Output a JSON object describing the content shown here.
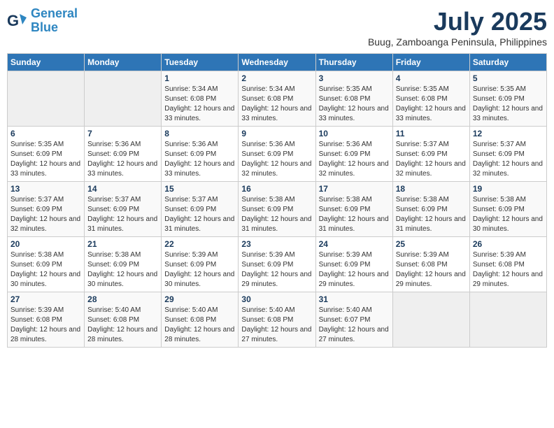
{
  "header": {
    "logo_line1": "General",
    "logo_line2": "Blue",
    "month": "July 2025",
    "location": "Buug, Zamboanga Peninsula, Philippines"
  },
  "days_of_week": [
    "Sunday",
    "Monday",
    "Tuesday",
    "Wednesday",
    "Thursday",
    "Friday",
    "Saturday"
  ],
  "weeks": [
    [
      {
        "day": "",
        "info": ""
      },
      {
        "day": "",
        "info": ""
      },
      {
        "day": "1",
        "info": "Sunrise: 5:34 AM\nSunset: 6:08 PM\nDaylight: 12 hours and 33 minutes."
      },
      {
        "day": "2",
        "info": "Sunrise: 5:34 AM\nSunset: 6:08 PM\nDaylight: 12 hours and 33 minutes."
      },
      {
        "day": "3",
        "info": "Sunrise: 5:35 AM\nSunset: 6:08 PM\nDaylight: 12 hours and 33 minutes."
      },
      {
        "day": "4",
        "info": "Sunrise: 5:35 AM\nSunset: 6:08 PM\nDaylight: 12 hours and 33 minutes."
      },
      {
        "day": "5",
        "info": "Sunrise: 5:35 AM\nSunset: 6:09 PM\nDaylight: 12 hours and 33 minutes."
      }
    ],
    [
      {
        "day": "6",
        "info": "Sunrise: 5:35 AM\nSunset: 6:09 PM\nDaylight: 12 hours and 33 minutes."
      },
      {
        "day": "7",
        "info": "Sunrise: 5:36 AM\nSunset: 6:09 PM\nDaylight: 12 hours and 33 minutes."
      },
      {
        "day": "8",
        "info": "Sunrise: 5:36 AM\nSunset: 6:09 PM\nDaylight: 12 hours and 33 minutes."
      },
      {
        "day": "9",
        "info": "Sunrise: 5:36 AM\nSunset: 6:09 PM\nDaylight: 12 hours and 32 minutes."
      },
      {
        "day": "10",
        "info": "Sunrise: 5:36 AM\nSunset: 6:09 PM\nDaylight: 12 hours and 32 minutes."
      },
      {
        "day": "11",
        "info": "Sunrise: 5:37 AM\nSunset: 6:09 PM\nDaylight: 12 hours and 32 minutes."
      },
      {
        "day": "12",
        "info": "Sunrise: 5:37 AM\nSunset: 6:09 PM\nDaylight: 12 hours and 32 minutes."
      }
    ],
    [
      {
        "day": "13",
        "info": "Sunrise: 5:37 AM\nSunset: 6:09 PM\nDaylight: 12 hours and 32 minutes."
      },
      {
        "day": "14",
        "info": "Sunrise: 5:37 AM\nSunset: 6:09 PM\nDaylight: 12 hours and 31 minutes."
      },
      {
        "day": "15",
        "info": "Sunrise: 5:37 AM\nSunset: 6:09 PM\nDaylight: 12 hours and 31 minutes."
      },
      {
        "day": "16",
        "info": "Sunrise: 5:38 AM\nSunset: 6:09 PM\nDaylight: 12 hours and 31 minutes."
      },
      {
        "day": "17",
        "info": "Sunrise: 5:38 AM\nSunset: 6:09 PM\nDaylight: 12 hours and 31 minutes."
      },
      {
        "day": "18",
        "info": "Sunrise: 5:38 AM\nSunset: 6:09 PM\nDaylight: 12 hours and 31 minutes."
      },
      {
        "day": "19",
        "info": "Sunrise: 5:38 AM\nSunset: 6:09 PM\nDaylight: 12 hours and 30 minutes."
      }
    ],
    [
      {
        "day": "20",
        "info": "Sunrise: 5:38 AM\nSunset: 6:09 PM\nDaylight: 12 hours and 30 minutes."
      },
      {
        "day": "21",
        "info": "Sunrise: 5:38 AM\nSunset: 6:09 PM\nDaylight: 12 hours and 30 minutes."
      },
      {
        "day": "22",
        "info": "Sunrise: 5:39 AM\nSunset: 6:09 PM\nDaylight: 12 hours and 30 minutes."
      },
      {
        "day": "23",
        "info": "Sunrise: 5:39 AM\nSunset: 6:09 PM\nDaylight: 12 hours and 29 minutes."
      },
      {
        "day": "24",
        "info": "Sunrise: 5:39 AM\nSunset: 6:09 PM\nDaylight: 12 hours and 29 minutes."
      },
      {
        "day": "25",
        "info": "Sunrise: 5:39 AM\nSunset: 6:08 PM\nDaylight: 12 hours and 29 minutes."
      },
      {
        "day": "26",
        "info": "Sunrise: 5:39 AM\nSunset: 6:08 PM\nDaylight: 12 hours and 29 minutes."
      }
    ],
    [
      {
        "day": "27",
        "info": "Sunrise: 5:39 AM\nSunset: 6:08 PM\nDaylight: 12 hours and 28 minutes."
      },
      {
        "day": "28",
        "info": "Sunrise: 5:40 AM\nSunset: 6:08 PM\nDaylight: 12 hours and 28 minutes."
      },
      {
        "day": "29",
        "info": "Sunrise: 5:40 AM\nSunset: 6:08 PM\nDaylight: 12 hours and 28 minutes."
      },
      {
        "day": "30",
        "info": "Sunrise: 5:40 AM\nSunset: 6:08 PM\nDaylight: 12 hours and 27 minutes."
      },
      {
        "day": "31",
        "info": "Sunrise: 5:40 AM\nSunset: 6:07 PM\nDaylight: 12 hours and 27 minutes."
      },
      {
        "day": "",
        "info": ""
      },
      {
        "day": "",
        "info": ""
      }
    ]
  ]
}
